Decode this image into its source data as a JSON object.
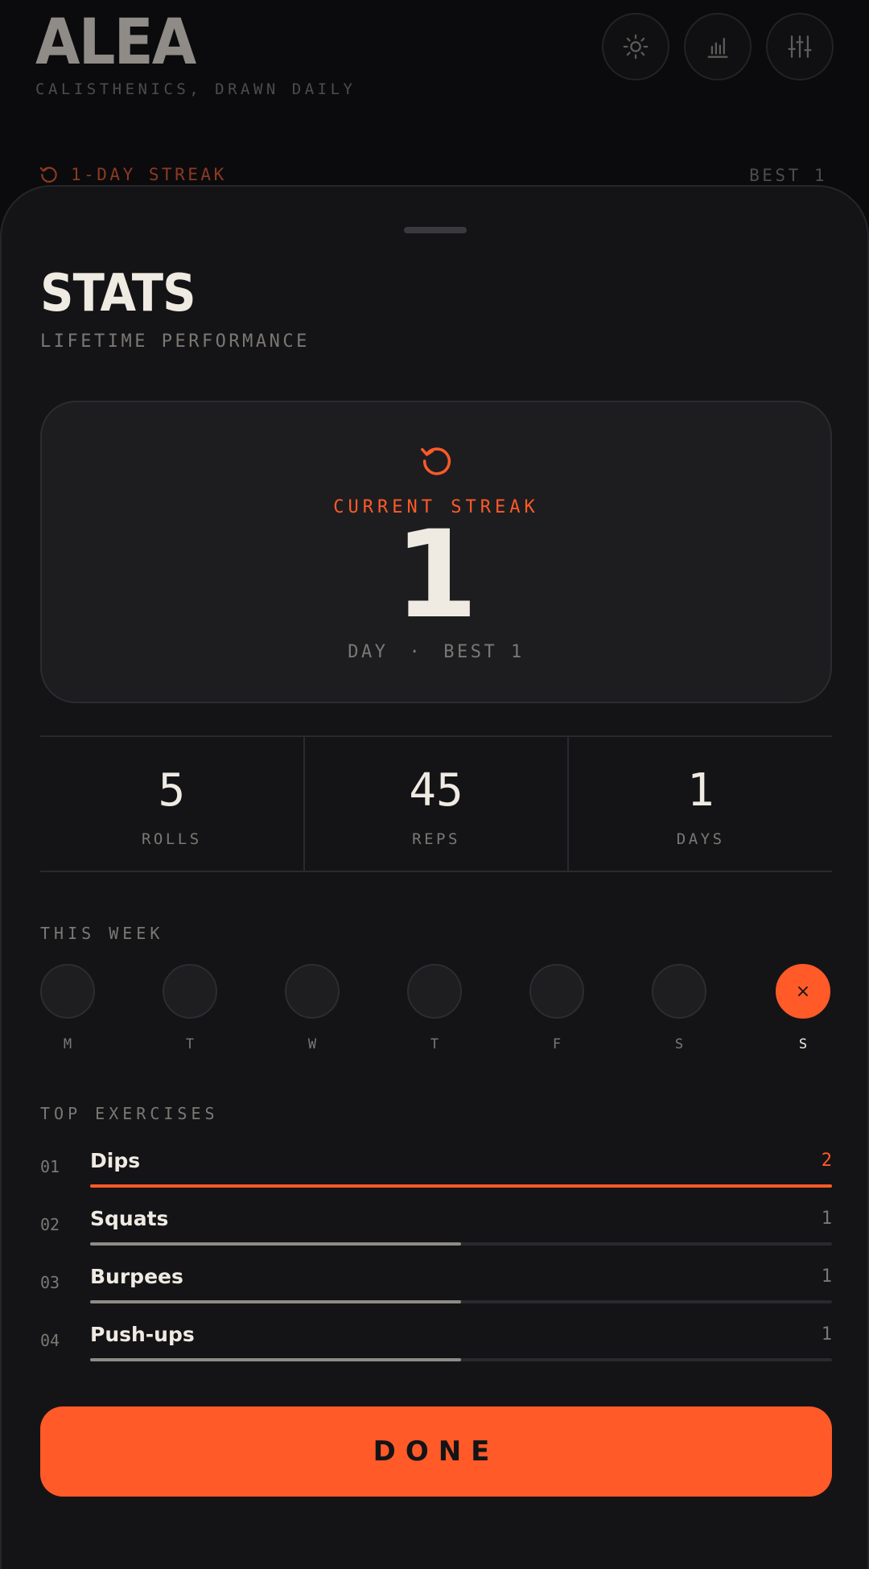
{
  "app": {
    "logo": "ALEA",
    "tagline": "CALISTHENICS, DRAWN DAILY",
    "streak_text": "1-DAY STREAK",
    "best_text": "BEST 1",
    "icons": [
      "sun-icon",
      "bar-chart-icon",
      "sliders-icon",
      "streak-icon"
    ]
  },
  "sheet": {
    "title": "STATS",
    "subtitle": "LIFETIME PERFORMANCE",
    "streak_card": {
      "label": "CURRENT STREAK",
      "value": "1",
      "unit": "DAY",
      "separator": "·",
      "best": "BEST 1"
    },
    "stats": [
      {
        "value": "5",
        "label": "ROLLS"
      },
      {
        "value": "45",
        "label": "REPS"
      },
      {
        "value": "1",
        "label": "DAYS"
      }
    ],
    "week": {
      "label": "THIS WEEK",
      "days": [
        {
          "letter": "M",
          "active": false,
          "mark": ""
        },
        {
          "letter": "T",
          "active": false,
          "mark": ""
        },
        {
          "letter": "W",
          "active": false,
          "mark": ""
        },
        {
          "letter": "T",
          "active": false,
          "mark": ""
        },
        {
          "letter": "F",
          "active": false,
          "mark": ""
        },
        {
          "letter": "S",
          "active": false,
          "mark": ""
        },
        {
          "letter": "S",
          "active": true,
          "mark": "×"
        }
      ]
    },
    "top_exercises": {
      "label": "TOP EXERCISES",
      "items": [
        {
          "rank": "01",
          "name": "Dips",
          "count": "2",
          "fraction": 1.0,
          "lead": true
        },
        {
          "rank": "02",
          "name": "Squats",
          "count": "1",
          "fraction": 0.5,
          "lead": false
        },
        {
          "rank": "03",
          "name": "Burpees",
          "count": "1",
          "fraction": 0.5,
          "lead": false
        },
        {
          "rank": "04",
          "name": "Push-ups",
          "count": "1",
          "fraction": 0.5,
          "lead": false
        }
      ]
    },
    "done_label": "DONE"
  },
  "colors": {
    "accent": "#ff5a28",
    "background": "#141416",
    "text": "#efeae2",
    "muted": "#7b7874"
  }
}
